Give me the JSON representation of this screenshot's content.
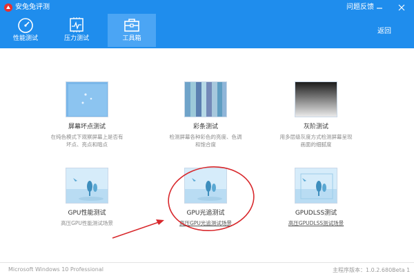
{
  "window": {
    "title": "安兔兔评测",
    "feedback": "问题反馈",
    "back": "返回"
  },
  "nav": {
    "tabs": [
      {
        "label": "性能测试",
        "icon": "speedometer-icon"
      },
      {
        "label": "压力测试",
        "icon": "chip-pulse-icon"
      },
      {
        "label": "工具箱",
        "icon": "toolbox-icon",
        "active": true
      }
    ]
  },
  "tools": [
    {
      "title": "屏幕坏点测试",
      "desc_line1": "在纯色模式下观察屏幕上是否有",
      "desc_line2": "坏点、亮点和暗点"
    },
    {
      "title": "彩条测试",
      "desc_line1": "检测屏幕各种彩色的亮度、色调",
      "desc_line2": "和饱合度"
    },
    {
      "title": "灰阶测试",
      "desc_line1": "用多层级灰度方式检测屏幕呈现",
      "desc_line2": "画面的细腻度"
    },
    {
      "title": "GPU性能测试",
      "desc_line1": "高压GPU性能测试场景"
    },
    {
      "title": "GPU光追测试",
      "desc_line1": "高压GPU光追测试场景"
    },
    {
      "title": "GPUDLSS测试",
      "desc_line1": "高压GPUDLSS测试场景"
    }
  ],
  "status": {
    "os": "Microsoft Windows 10 Professional",
    "version": "主程序版本：1.0.2.680Beta 1"
  },
  "colors": {
    "titlebar": "#1f8ded",
    "active_tab": "#4ba5f4",
    "annotation": "#d8282c"
  }
}
